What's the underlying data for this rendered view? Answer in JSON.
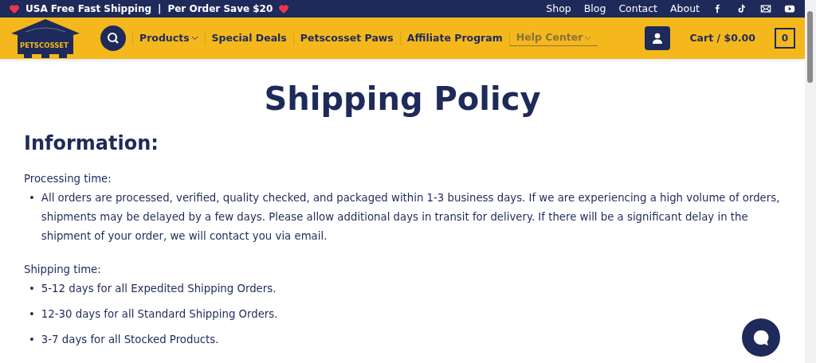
{
  "top_bar": {
    "promo": [
      {
        "text": "USA Free Fast Shipping"
      },
      {
        "text": "|"
      },
      {
        "text": "Per Order Save $20"
      }
    ],
    "links": [
      "Shop",
      "Blog",
      "Contact",
      "About"
    ]
  },
  "header": {
    "logo": "PETSCOSSET",
    "nav": [
      {
        "label": "Products",
        "dropdown": true,
        "selected": false
      },
      {
        "label": "Special Deals",
        "dropdown": false,
        "selected": false
      },
      {
        "label": "Petscosset Paws",
        "dropdown": false,
        "selected": false
      },
      {
        "label": "Affiliate Program",
        "dropdown": false,
        "selected": false
      },
      {
        "label": "Help Center",
        "dropdown": true,
        "selected": true
      }
    ],
    "cart": "Cart / $0.00",
    "cart_count": "0"
  },
  "page": {
    "title": "Shipping Policy",
    "heading": "Information:",
    "sections": [
      {
        "label": "Processing time:",
        "items": [
          {
            "bullet": "•",
            "text": "All orders are processed, verified, quality checked, and packaged within 1-3 business days. If we are experiencing a high volume of orders, shipments may be delayed by a few days. Please allow additional days in transit for delivery. If there will be a significant delay in the shipment of your order, we will contact you via email."
          }
        ]
      },
      {
        "label": "Shipping time:",
        "items": [
          {
            "bullet": "•",
            "text": "5-12 days for all Expedited Shipping Orders."
          },
          {
            "bullet": "•",
            "text": "12-30 days for all Standard Shipping Orders."
          },
          {
            "bullet": "•",
            "text": "3-7 days for all Stocked Products."
          }
        ]
      }
    ]
  }
}
